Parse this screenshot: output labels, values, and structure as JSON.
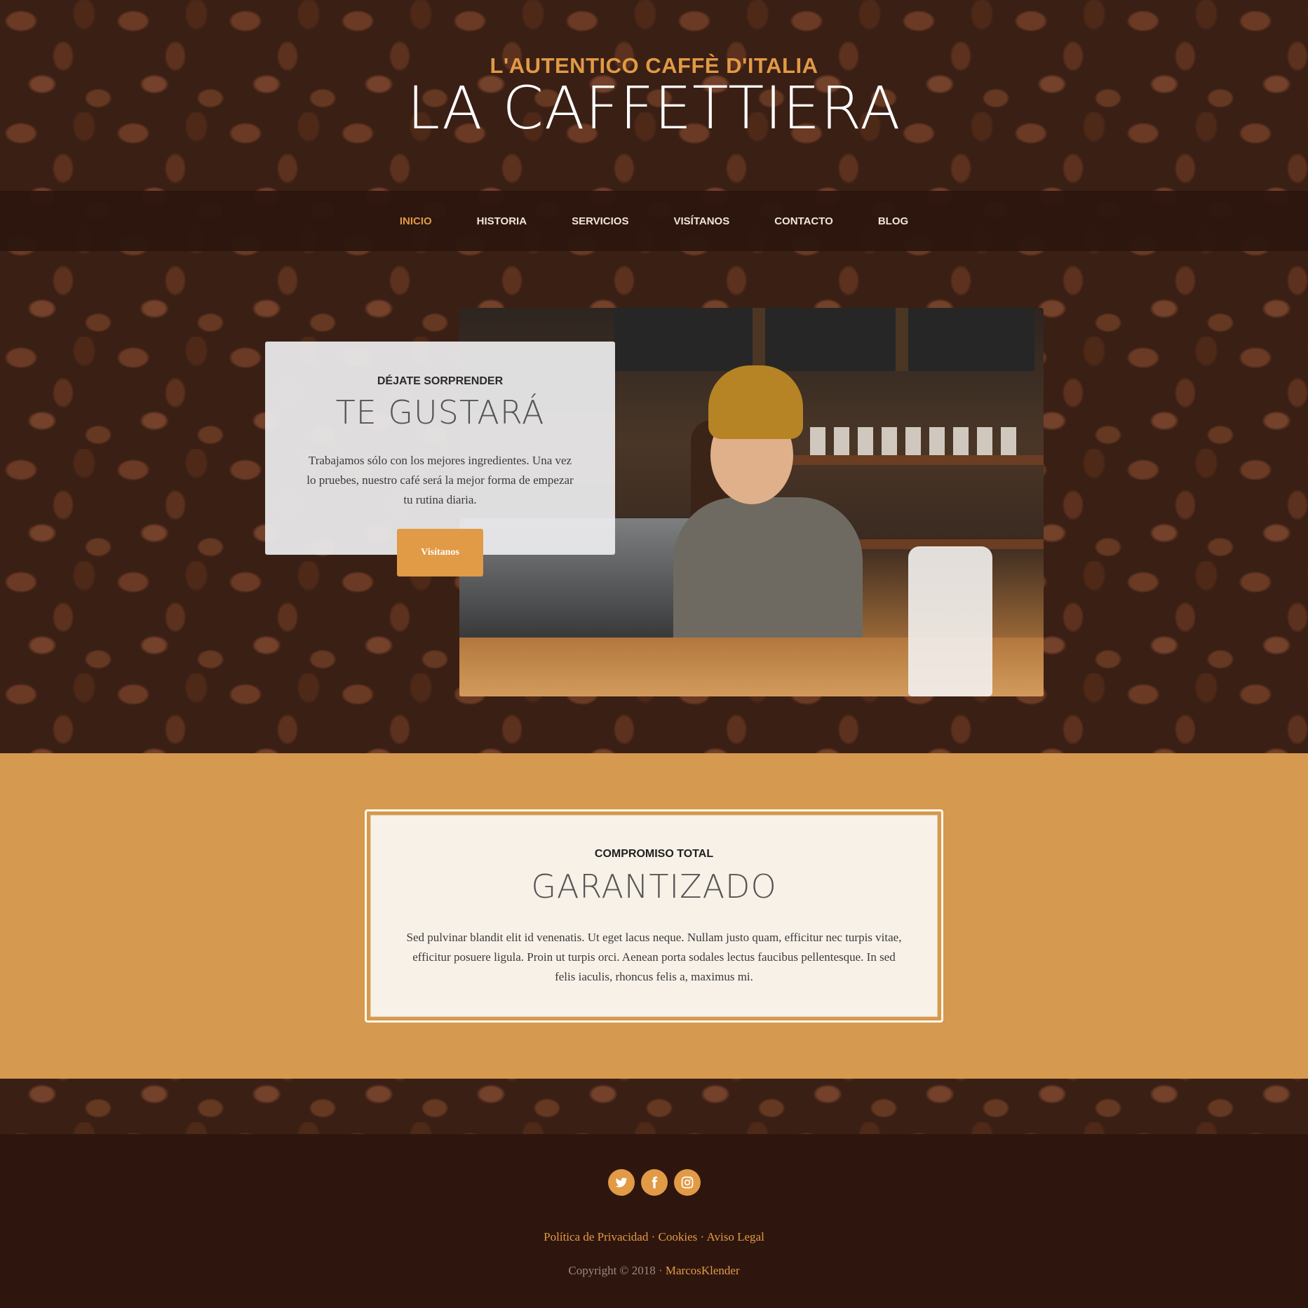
{
  "header": {
    "tagline": "L'AUTENTICO CAFFÈ D'ITALIA",
    "brand": "LA CAFFETTIERA"
  },
  "nav": {
    "items": [
      {
        "label": "INICIO",
        "active": true
      },
      {
        "label": "HISTORIA"
      },
      {
        "label": "SERVICIOS"
      },
      {
        "label": "VISÍTANOS"
      },
      {
        "label": "CONTACTO"
      },
      {
        "label": "BLOG"
      }
    ]
  },
  "hero": {
    "kicker": "DÉJATE SORPRENDER",
    "title": "TE GUSTARÁ",
    "text": "Trabajamos sólo con los mejores ingredientes. Una vez lo pruebes, nuestro café será la mejor forma de empezar tu rutina diaria.",
    "button_label": "Visítanos"
  },
  "promise": {
    "kicker": "COMPROMISO TOTAL",
    "title": "GARANTIZADO",
    "text": "Sed pulvinar blandit elit id venenatis. Ut eget lacus neque. Nullam justo quam, efficitur nec turpis vitae, efficitur posuere ligula. Proin ut turpis orci. Aenean porta sodales lectus faucibus pellentesque. In sed felis iaculis, rhoncus felis a, maximus mi."
  },
  "footer": {
    "socials": [
      "twitter-icon",
      "facebook-icon",
      "instagram-icon"
    ],
    "links": [
      "Política de Privacidad",
      "Cookies",
      "Aviso Legal"
    ],
    "separator": "·",
    "copyright_prefix": "Copyright © 2018 ·",
    "copyright_author": "MarcosKlender"
  },
  "colors": {
    "accent": "#e19a45",
    "nav_bg": "#2b150e",
    "promise_bg": "#d59a4f",
    "footer_bg": "#2e160f"
  }
}
